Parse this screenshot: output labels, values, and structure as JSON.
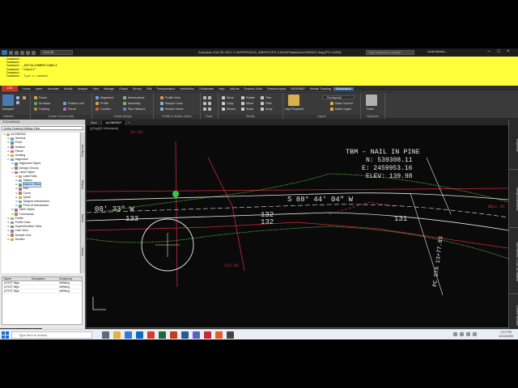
{
  "app": {
    "workspace": "Civil 3D",
    "title": "Autodesk Civil 3D 2021   C:\\WIP\\PS\\2016_WB\\PSC\\PS-CADD\\Plantwin\\ALGNR002.dwg [PS-CADD]",
    "search_placeholder": "Type a keyword or phrase",
    "user": "scotter@diskc..."
  },
  "command_line": {
    "lines": [
      "Command:",
      "Command:",
      "Command: _EDITALIGNMENTLABELS",
      "Command: *Cancel*",
      "Command:",
      "Command:"
    ],
    "input_placeholder": "Type a command"
  },
  "menu": {
    "logo": "C3D",
    "items": [
      "Home",
      "Insert",
      "Annotate",
      "Modify",
      "Analyze",
      "View",
      "Manage",
      "Output",
      "Survey",
      "Rail",
      "Transportation",
      "InfraWorks",
      "Collaborate",
      "Help",
      "Add-ins",
      "Express Tools",
      "Featured Apps",
      "BASEMAP",
      "Vehicle Tracking",
      "Geolocation"
    ],
    "active_index": 19
  },
  "ribbon": {
    "toolspace_label": "Toolspace",
    "palettes": {
      "label": "Palettes"
    },
    "create_ground": {
      "label": "Create Ground Data",
      "items": [
        "Points",
        "Surfaces",
        "Grading"
      ],
      "items2": [
        "Feature Line",
        "Parcel"
      ]
    },
    "create_design": {
      "label": "Create Design",
      "items": [
        "Alignment",
        "Profile",
        "Corridor"
      ],
      "items2": [
        "Intersections",
        "Assembly",
        "Pipe Network"
      ]
    },
    "profile_section": {
      "label": "Profile & Section Views",
      "items": [
        "Profile View",
        "Sample Lines",
        "Section Views"
      ]
    },
    "draw": {
      "label": "Draw"
    },
    "modify": {
      "label": "Modify",
      "items": [
        "Move",
        "Copy",
        "Stretch"
      ],
      "items2": [
        "Rotate",
        "Mirror",
        "Scale"
      ],
      "items3": [
        "Trim",
        "Fillet",
        "Array"
      ]
    },
    "layers": {
      "label": "Layers",
      "items": [
        "Layer Properties",
        "Make Current",
        "Match Layer"
      ],
      "combo": "PenAsphalt"
    },
    "clipboard": {
      "label": "Clipboard",
      "paste": "Paste"
    }
  },
  "toolspace": {
    "title": "TOOLSPACE",
    "view_selector": "Active Drawing Settings View",
    "tree": [
      {
        "label": "ALGNR002",
        "level": 0,
        "exp": "-"
      },
      {
        "label": "General",
        "level": 1,
        "exp": "+"
      },
      {
        "label": "Point",
        "level": 1,
        "exp": "+"
      },
      {
        "label": "Surface",
        "level": 1,
        "exp": "+"
      },
      {
        "label": "Parcel",
        "level": 1,
        "exp": "+"
      },
      {
        "label": "Grading",
        "level": 1,
        "exp": "+"
      },
      {
        "label": "Alignment",
        "level": 1,
        "exp": "-"
      },
      {
        "label": "Alignment Styles",
        "level": 2,
        "exp": "+"
      },
      {
        "label": "Design Checks",
        "level": 2,
        "exp": "+"
      },
      {
        "label": "Label Styles",
        "level": 2,
        "exp": "-"
      },
      {
        "label": "Label Sets",
        "level": 3,
        "exp": "+"
      },
      {
        "label": "Station",
        "level": 3,
        "exp": "+"
      },
      {
        "label": "Station Offset",
        "level": 3,
        "exp": "+",
        "selected": true
      },
      {
        "label": "Line",
        "level": 3,
        "exp": "+"
      },
      {
        "label": "Curve",
        "level": 3,
        "exp": "+"
      },
      {
        "label": "Spiral",
        "level": 3,
        "exp": "+"
      },
      {
        "label": "Tangent Intersection",
        "level": 3,
        "exp": "+"
      },
      {
        "label": "Point of Intersection",
        "level": 3,
        "exp": "+"
      },
      {
        "label": "Table Styles",
        "level": 2,
        "exp": "+"
      },
      {
        "label": "Commands",
        "level": 2,
        "exp": "+"
      },
      {
        "label": "Profile",
        "level": 1,
        "exp": "+"
      },
      {
        "label": "Profile View",
        "level": 1,
        "exp": "+"
      },
      {
        "label": "Superelevation View",
        "level": 1,
        "exp": "+"
      },
      {
        "label": "Cant View",
        "level": 1,
        "exp": "+"
      },
      {
        "label": "Sample Line",
        "level": 1,
        "exp": "+"
      },
      {
        "label": "Section",
        "level": 1,
        "exp": "+"
      }
    ],
    "vtabs": [
      "Prospector",
      "Settings",
      "Survey",
      "Toolbox"
    ],
    "table": {
      "headers": [
        "Name",
        "Description",
        "Created by"
      ],
      "rows": [
        [
          "pTOOT Align",
          "",
          "rdWiking"
        ],
        [
          "pTOOT Align",
          "",
          "rdWiking"
        ],
        [
          "pTOOT Align",
          "",
          "rdWiking"
        ]
      ]
    }
  },
  "doc_tabs": {
    "items": [
      "Start",
      "ALGNR002*"
    ],
    "active_index": 1,
    "add": "+"
  },
  "viewport_control": "[-][Top][2D Wireframe]",
  "drawing": {
    "tbm": [
      "TBM – NAIL IN PINE",
      "N: 539308.11",
      "E: 2459953.16",
      "ELEV: 139.98"
    ],
    "bearing_left": "08' 33\" W",
    "bearing_right": "S 88° 44' 04\" W",
    "num_133": "133",
    "num_132a": "132",
    "num_132b": "132",
    "num_131": "131",
    "station": "PC STA 13+77.83",
    "well_lbl": "WELL 8C",
    "small_lbl": "24.66",
    "small_lbl2": "115.86"
  },
  "right_palettes": [
    "Properties",
    "Design Automation",
    "Tool Palettes - CIVIL 3D Imperial",
    "Content Browser"
  ],
  "layout_tabs": {
    "items": [
      "Model",
      "Layout1",
      "+"
    ],
    "active_index": 0
  },
  "status": {
    "coords": "2459759.225, 539275.265, 0.000",
    "model": "MODEL",
    "scale": "1\" = 40'",
    "workspace": "C3D"
  },
  "taskbar": {
    "search_placeholder": "Type here to search",
    "time": "2:17 PM",
    "date": "12/11/2020"
  },
  "colors": {
    "command_bg": "#ffff3a",
    "accent": "#3d6fb3",
    "green_line": "#6fd34a",
    "red_line": "#c8283c",
    "drawing_bg": "#0a0a0a"
  }
}
